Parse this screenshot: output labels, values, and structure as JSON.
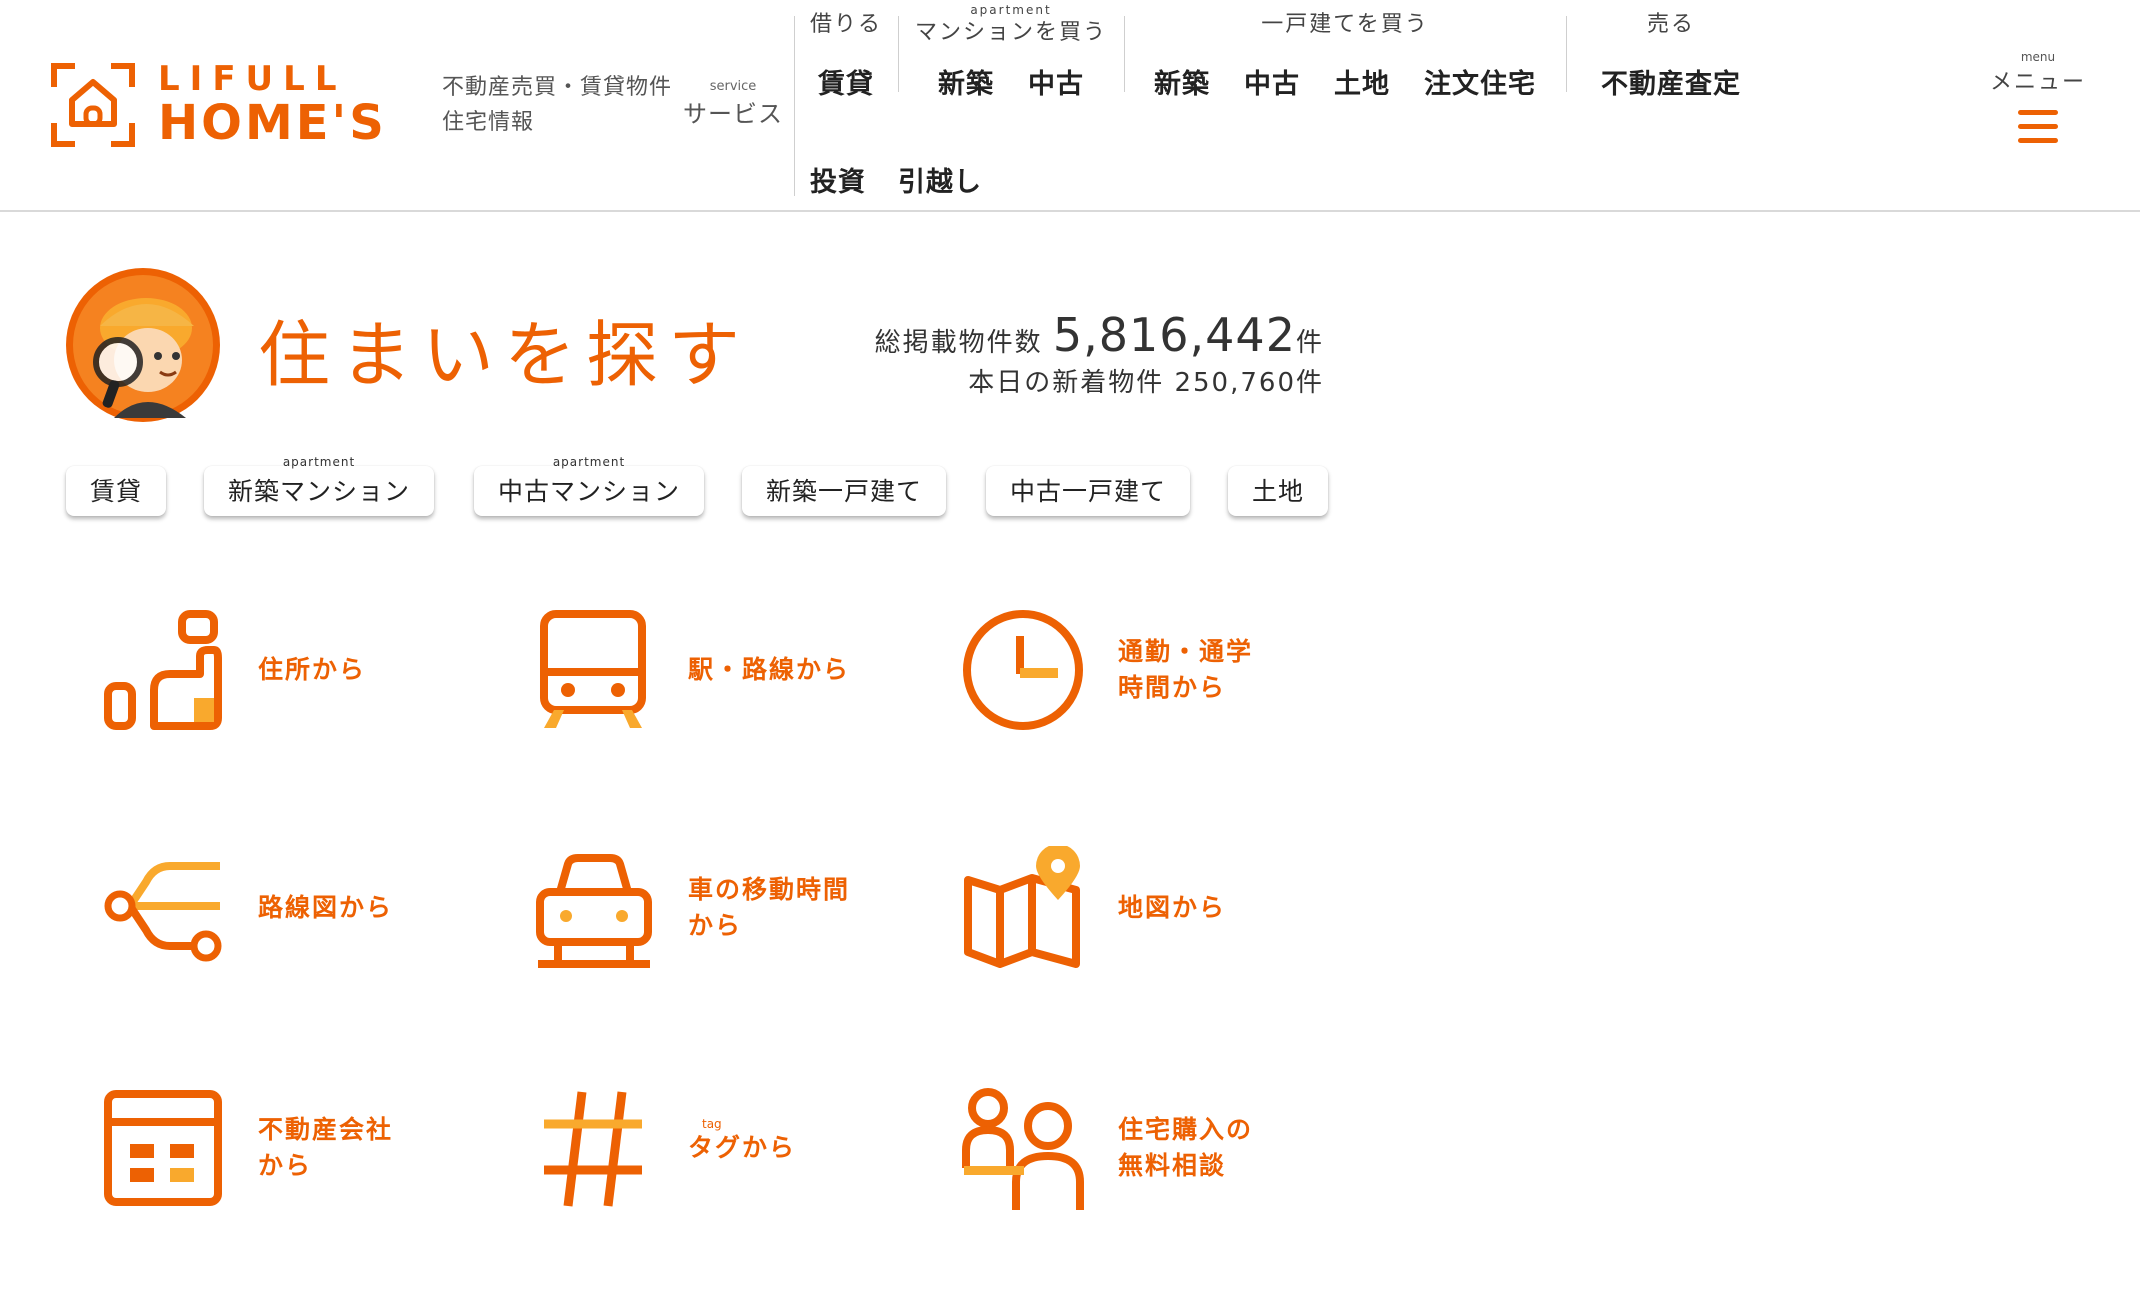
{
  "colors": {
    "accent": "#ed6103",
    "accent_light": "#f9a92d",
    "text": "#222222",
    "divider": "#cfcfcf"
  },
  "logo": {
    "line1": "LIFULL",
    "line2": "HOME'S"
  },
  "header": {
    "desc_line1": "不動産売買・賃貸物件",
    "desc_line2": "住宅情報",
    "service": {
      "sup": "service",
      "label": "サービス"
    },
    "groups": {
      "rent": {
        "title": "借りる",
        "items": [
          "賃貸"
        ]
      },
      "mansion": {
        "sup": "apartment",
        "title": "マンションを買う",
        "items": [
          "新築",
          "中古"
        ]
      },
      "house": {
        "title": "一戸建てを買う",
        "items": [
          "新築",
          "中古",
          "土地",
          "注文住宅"
        ]
      },
      "sell": {
        "title": "売る",
        "items": [
          "不動産査定"
        ]
      },
      "other": {
        "items": [
          "投資",
          "引越し"
        ]
      }
    },
    "menu": {
      "sup": "menu",
      "label": "メニュー",
      "icon": "hamburger-icon"
    }
  },
  "search": {
    "title": "住まいを探す",
    "mascot_icon": "mascot-detective-icon",
    "total_label": "総掲載物件数",
    "total_count": "5,816,442",
    "total_unit": "件",
    "today_label": "本日の新着物件",
    "today_count": "250,760件"
  },
  "tabs": [
    {
      "label": "賃貸",
      "sup": ""
    },
    {
      "label": "新築マンション",
      "sup": "apartment"
    },
    {
      "label": "中古マンション",
      "sup": "apartment"
    },
    {
      "label": "新築一戸建て",
      "sup": ""
    },
    {
      "label": "中古一戸建て",
      "sup": ""
    },
    {
      "label": "土地",
      "sup": ""
    }
  ],
  "methods": [
    {
      "icon": "address-icon",
      "line1": "住所から",
      "line2": ""
    },
    {
      "icon": "train-icon",
      "line1": "駅・路線から",
      "line2": ""
    },
    {
      "icon": "clock-icon",
      "line1": "通勤・通学",
      "line2": "時間から"
    },
    {
      "icon": "route-map-icon",
      "line1": "路線図から",
      "line2": ""
    },
    {
      "icon": "car-icon",
      "line1": "車の移動時間",
      "line2": "から"
    },
    {
      "icon": "map-pin-icon",
      "line1": "地図から",
      "line2": ""
    },
    {
      "icon": "building-icon",
      "line1": "不動産会社",
      "line2": "から"
    },
    {
      "icon": "hashtag-icon",
      "line1": "タグから",
      "line2": "",
      "sup": "tag"
    },
    {
      "icon": "consultation-people-icon",
      "line1": "住宅購入の",
      "line2": "無料相談"
    }
  ]
}
